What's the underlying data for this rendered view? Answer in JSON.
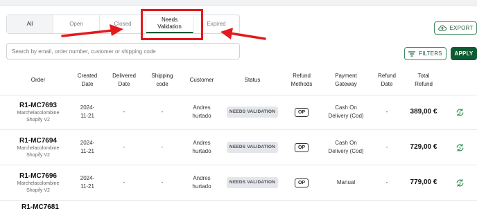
{
  "tabs": [
    {
      "label": "All"
    },
    {
      "label": "Open"
    },
    {
      "label": "Closed"
    },
    {
      "label": "Needs Validation"
    },
    {
      "label": "Expired"
    }
  ],
  "search": {
    "placeholder": "Search by email, order number, customer or shipping code"
  },
  "toolbar": {
    "export_label": "EXPORT",
    "filters_label": "FILTERS",
    "apply_label": "APPLY"
  },
  "colors": {
    "accent": "#0e5a33",
    "highlight": "#e3191c"
  },
  "icons": {
    "export": "cloud-upload-icon",
    "filters": "filter-lines-icon",
    "refund": "refund-cycle-icon"
  },
  "columns": [
    "Order",
    "Created Date",
    "Delivered Date",
    "Shipping code",
    "Customer",
    "Status",
    "Refund Methods",
    "Payment Gateway",
    "Refund Date",
    "Total Refund"
  ],
  "rows": [
    {
      "order": "R1-MC7693",
      "shop": "Marchelacolombine Shopify V2",
      "created": "2024-11-21",
      "delivered": "-",
      "shipping": "-",
      "customer": "Andres hurtado",
      "status": "NEEDS VALIDATION",
      "method": "OP",
      "gateway": "Cash On Delivery (Cod)",
      "refund_date": "-",
      "total": "389,00 €"
    },
    {
      "order": "R1-MC7694",
      "shop": "Marchelacolombine Shopify V2",
      "created": "2024-11-21",
      "delivered": "-",
      "shipping": "-",
      "customer": "Andres hurtado",
      "status": "NEEDS VALIDATION",
      "method": "OP",
      "gateway": "Cash On Delivery (Cod)",
      "refund_date": "-",
      "total": "729,00 €"
    },
    {
      "order": "R1-MC7696",
      "shop": "Marchelacolombine Shopify V2",
      "created": "2024-11-21",
      "delivered": "-",
      "shipping": "-",
      "customer": "Andres hurtado",
      "status": "NEEDS VALIDATION",
      "method": "OP",
      "gateway": "Manual",
      "refund_date": "-",
      "total": "779,00 €"
    }
  ],
  "partial_row_order": "R1-MC7681"
}
